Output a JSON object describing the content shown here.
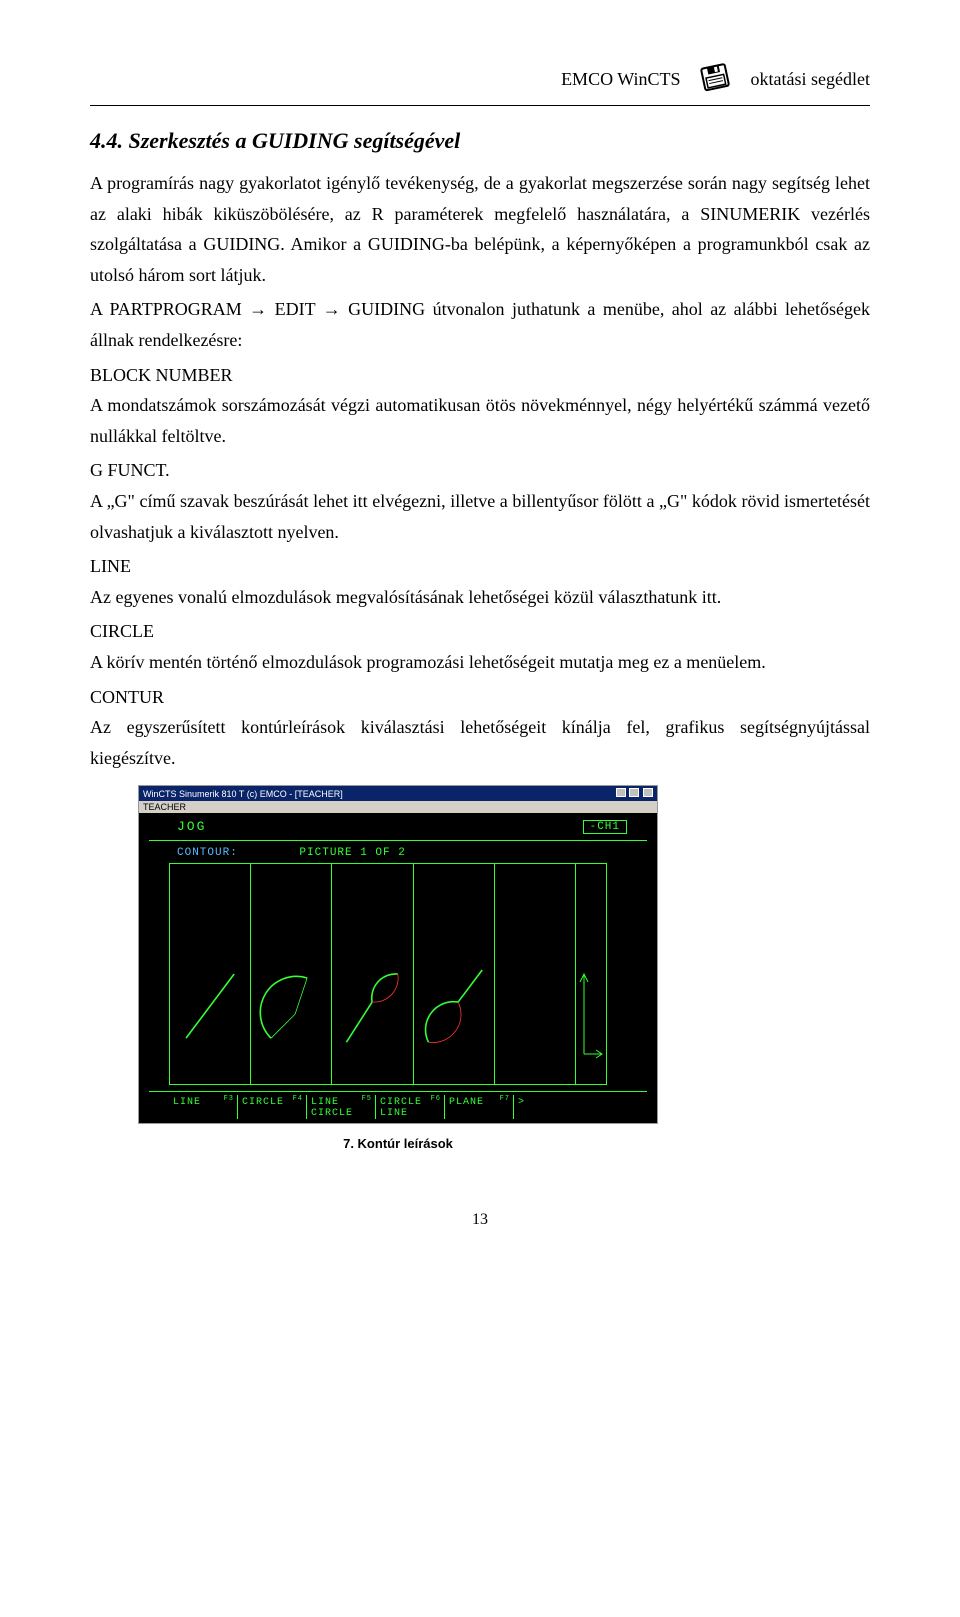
{
  "header": {
    "left": "EMCO WinCTS",
    "right": "oktatási segédlet"
  },
  "section": {
    "title": "4.4. Szerkesztés a GUIDING segítségével",
    "p1": "A programírás nagy gyakorlatot igénylő tevékenység, de a gyakorlat megszerzése során nagy segítség lehet az alaki hibák kiküszöbölésére, az R paraméterek megfelelő használatára, a SINUMERIK vezérlés szolgáltatása a GUIDING. Amikor a GUIDING-ba belépünk, a képernyőképen a programunkból csak az utolsó három sort látjuk.",
    "p2": "A PARTPROGRAM → EDIT → GUIDING útvonalon juthatunk a menübe, ahol az alábbi lehetőségek állnak rendelkezésre:"
  },
  "items": {
    "block_number": {
      "term": "BLOCK NUMBER",
      "desc": "A mondatszámok sorszámozását végzi automatikusan ötös növekménnyel, négy helyértékű számmá vezető nullákkal feltöltve."
    },
    "g_funct": {
      "term": "G FUNCT.",
      "desc": "A „G\" című szavak beszúrását lehet itt elvégezni, illetve a billentyűsor fölött a „G\" kódok rövid ismertetését olvashatjuk a kiválasztott nyelven."
    },
    "line": {
      "term": "LINE",
      "desc": "Az egyenes vonalú elmozdulások megvalósításának lehetőségei közül választhatunk itt."
    },
    "circle": {
      "term": "CIRCLE",
      "desc": "A körív mentén történő elmozdulások programozási lehetőségeit mutatja meg ez a menüelem."
    },
    "contur": {
      "term": "CONTUR",
      "desc": "Az egyszerűsített kontúrleírások kiválasztási lehetőségeit kínálja fel, grafikus segítségnyújtással kiegészítve."
    }
  },
  "figure": {
    "titlebar": "WinCTS Sinumerik 810 T (c) EMCO - [TEACHER]",
    "menubar": "TEACHER",
    "mode": "JOG",
    "channel": "-CH1",
    "contour_label": "CONTOUR:",
    "picture": "PICTURE 1 OF 2",
    "fkeys": [
      {
        "fn": "F3",
        "l1": "LINE",
        "l2": ""
      },
      {
        "fn": "F4",
        "l1": "CIRCLE",
        "l2": ""
      },
      {
        "fn": "F5",
        "l1": "LINE",
        "l2": "CIRCLE"
      },
      {
        "fn": "F6",
        "l1": "CIRCLE",
        "l2": "LINE"
      },
      {
        "fn": "F7",
        "l1": "PLANE",
        "l2": ""
      }
    ],
    "caption": "7. Kontúr leírások"
  },
  "page_number": "13"
}
